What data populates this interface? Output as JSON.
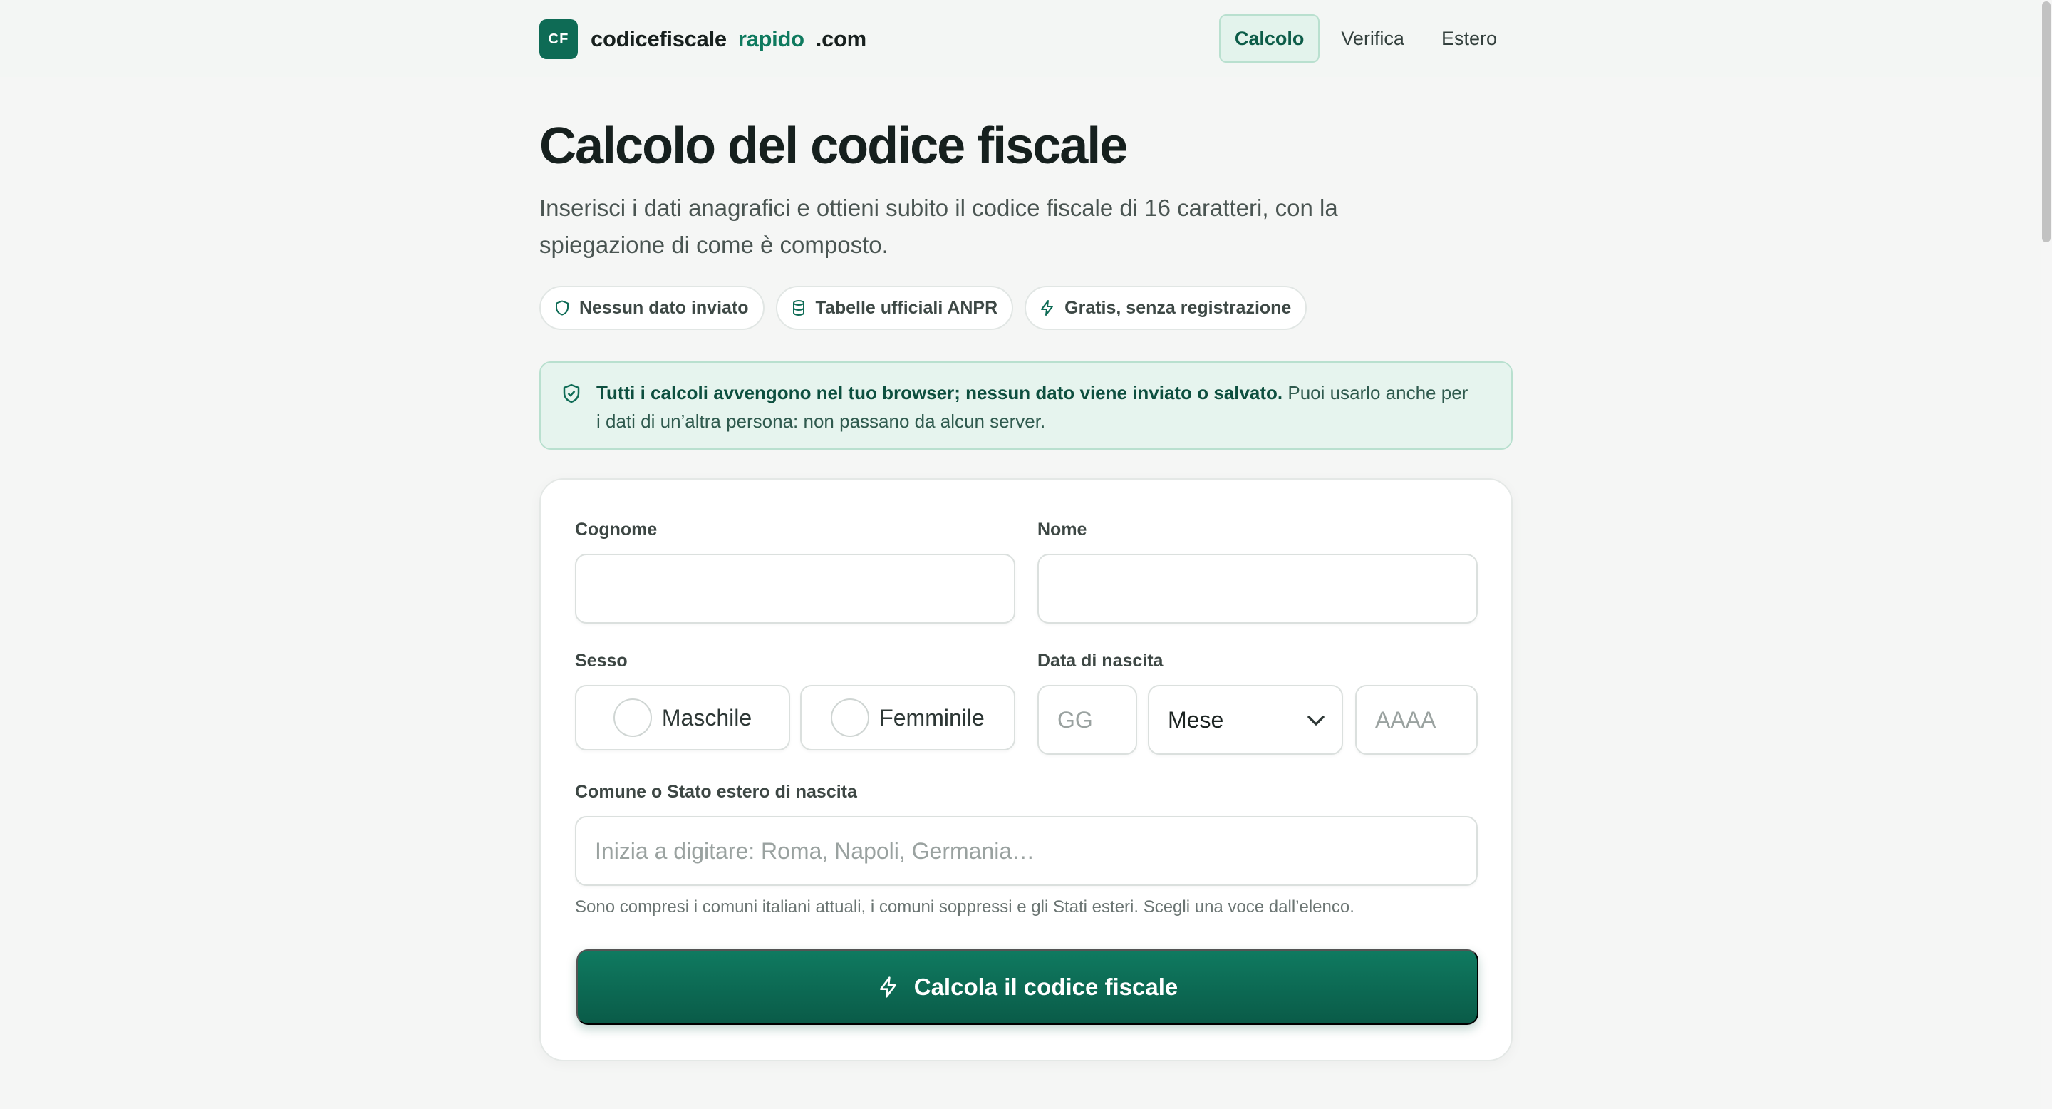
{
  "header": {
    "logo_text": "CF",
    "brand_part1": "codicefiscale",
    "brand_part2": "rapido",
    "brand_part3": ".com",
    "nav": [
      {
        "label": "Calcolo",
        "active": true
      },
      {
        "label": "Verifica",
        "active": false
      },
      {
        "label": "Estero",
        "active": false
      }
    ]
  },
  "hero": {
    "title": "Calcolo del codice fiscale",
    "subtitle": "Inserisci i dati anagrafici e ottieni subito il codice fiscale di 16 caratteri, con la spiegazione di come è composto."
  },
  "pills": [
    {
      "icon": "shield-icon",
      "label": "Nessun dato inviato"
    },
    {
      "icon": "database-icon",
      "label": "Tabelle ufficiali ANPR"
    },
    {
      "icon": "lightning-icon",
      "label": "Gratis, senza registrazione"
    }
  ],
  "notice": {
    "icon": "shield-check-icon",
    "bold": "Tutti i calcoli avvengono nel tuo browser; nessun dato viene inviato o salvato.",
    "text": " Puoi usarlo anche per i dati di un’altra persona: non passano da alcun server."
  },
  "form": {
    "cognome_label": "Cognome",
    "cognome_value": "",
    "nome_label": "Nome",
    "nome_value": "",
    "sesso_label": "Sesso",
    "sesso_options": [
      "Maschile",
      "Femminile"
    ],
    "data_label": "Data di nascita",
    "day_placeholder": "GG",
    "month_value": "Mese",
    "year_placeholder": "AAAA",
    "comune_label": "Comune o Stato estero di nascita",
    "comune_placeholder": "Inizia a digitare: Roma, Napoli, Germania…",
    "comune_hint": "Sono compresi i comuni italiani attuali, i comuni soppressi e gli Stati esteri. Scegli una voce dall’elenco.",
    "submit_label": "Calcola il codice fiscale"
  },
  "colors": {
    "brand": "#0e6b55",
    "accent_text": "#0e7a5e",
    "notice_bg": "#e6f4ee",
    "cta_top": "#0f7a60",
    "cta_bottom": "#0a5b48"
  }
}
